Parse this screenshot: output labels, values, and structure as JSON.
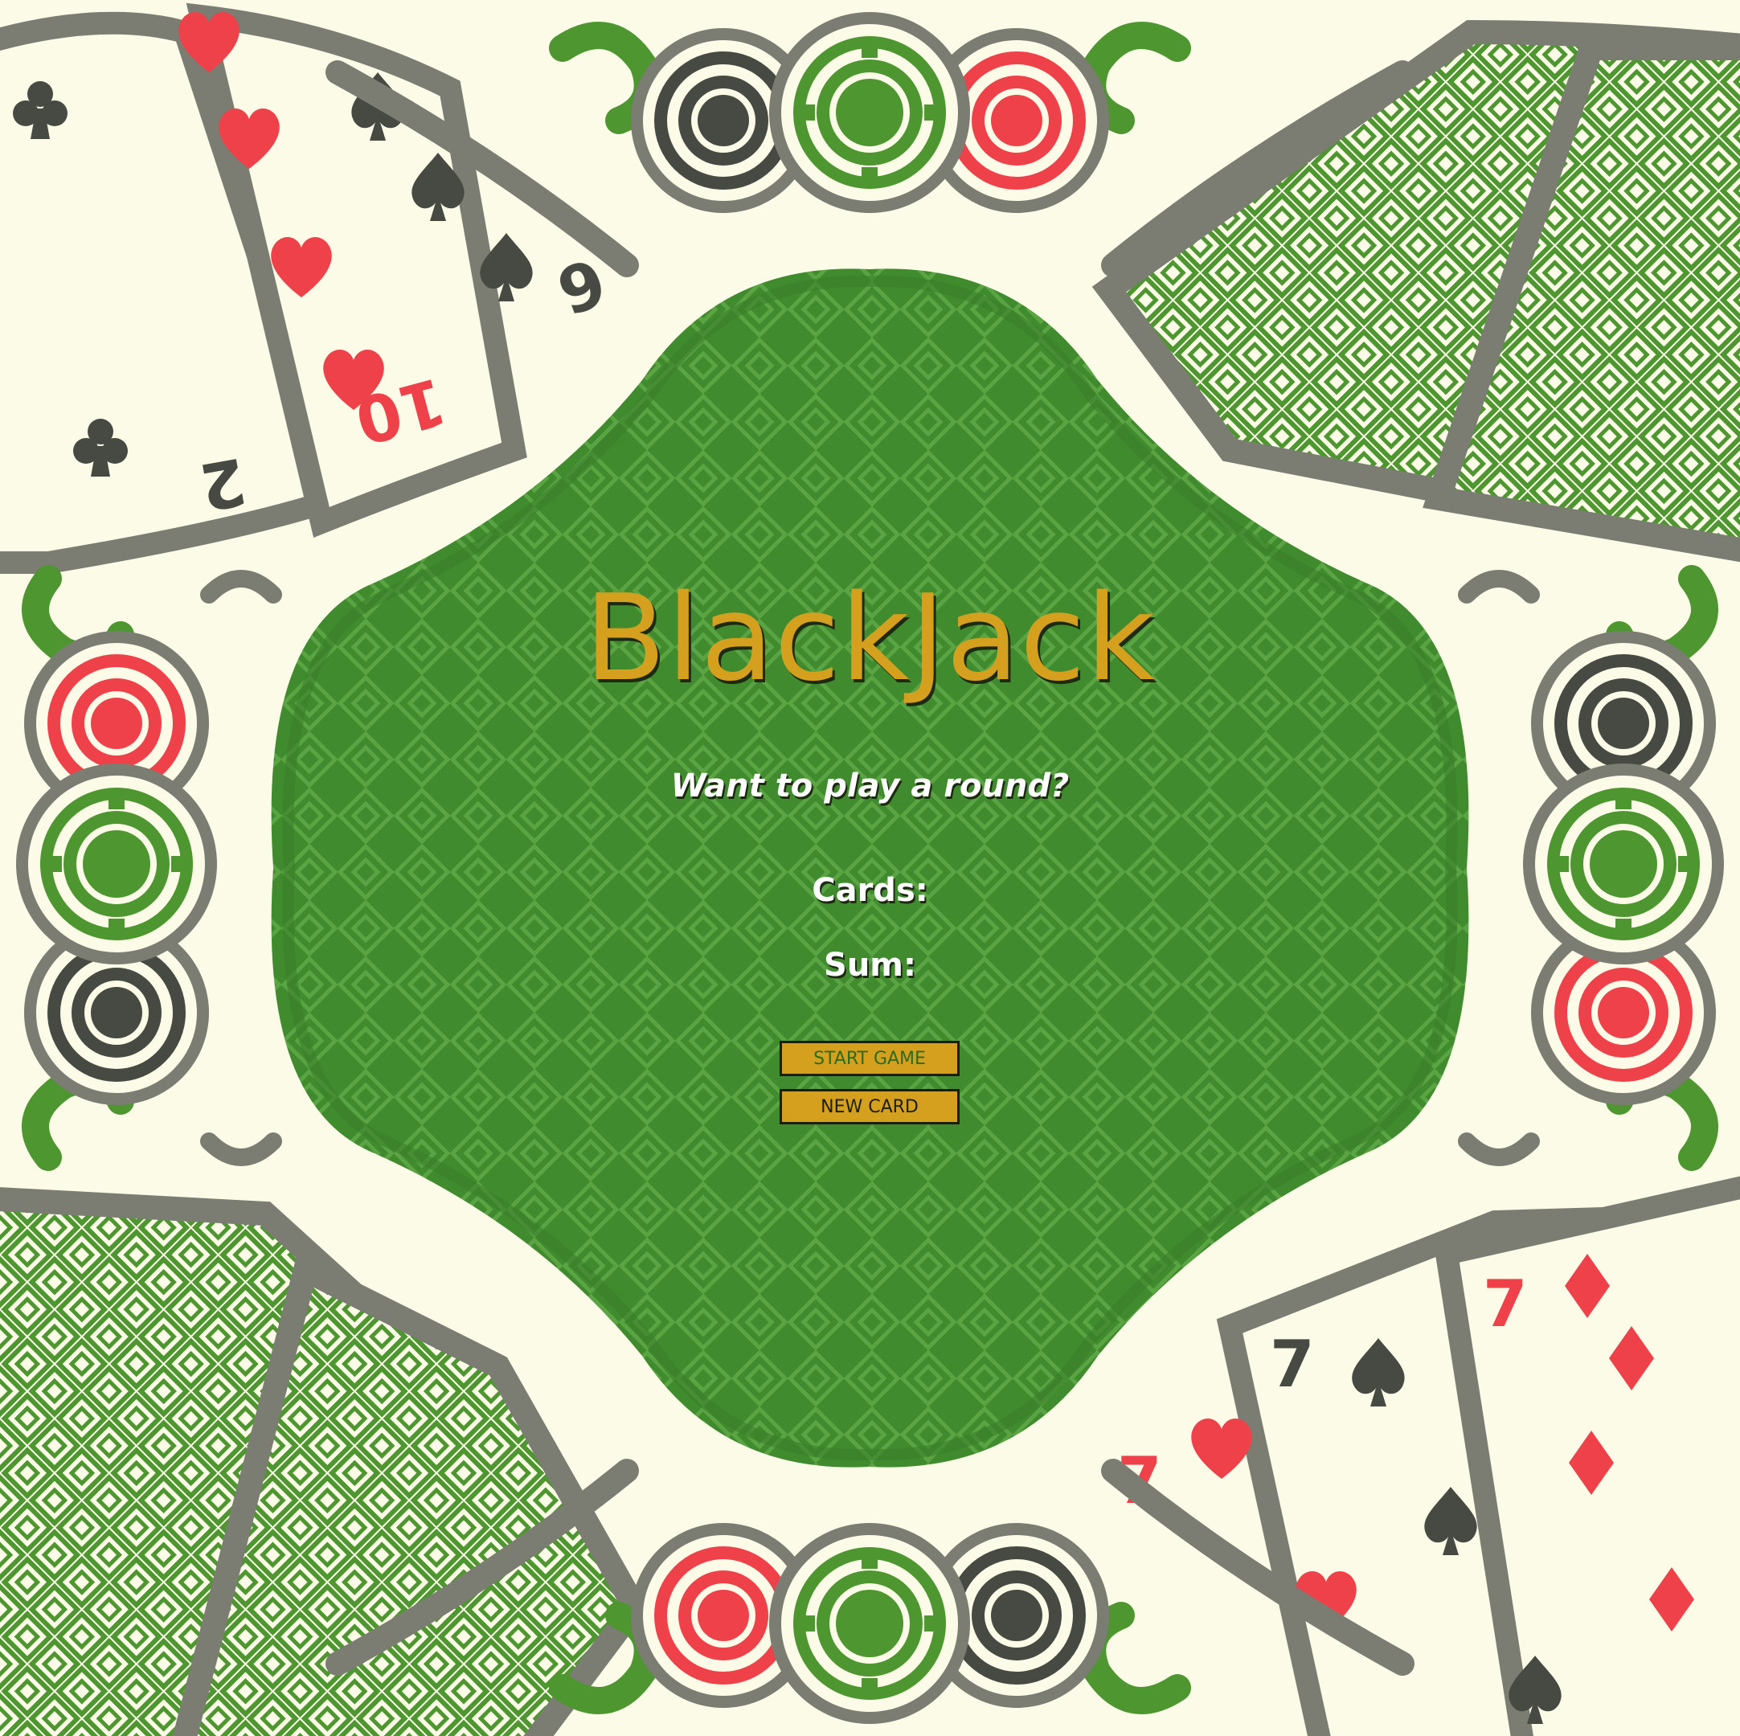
{
  "game": {
    "title": "BlackJack",
    "prompt": "Want to play a round?",
    "cards_label": "Cards:",
    "sum_label": "Sum:",
    "start_button": "START GAME",
    "new_card_button": "NEW CARD"
  },
  "decorations": {
    "cards_top_left": [
      "2",
      "10",
      "6"
    ],
    "cards_bottom_right": [
      "7",
      "7",
      "7"
    ]
  },
  "colors": {
    "background": "#fbfbe7",
    "felt": "#3d8a2c",
    "felt_pattern": "#5aa242",
    "gold": "#d4a01e",
    "gray": "#7b7c72",
    "red": "#ef4149",
    "dark": "#474a42",
    "green": "#4e962f"
  }
}
